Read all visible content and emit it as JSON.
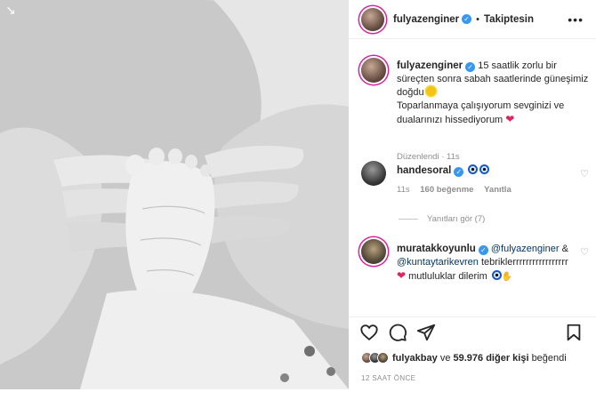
{
  "post": {
    "username": "fulyazenginer",
    "follow_status": "Takiptesin",
    "verified_badge": "✓"
  },
  "caption": {
    "username": "fulyazenginer",
    "line1": "15 saatlik zorlu bir süreçten sonra sabah saatlerinde güneşimiz doğdu",
    "line2": "Toparlanmaya çalışıyorum sevginizi ve dualarınızı hissediyorum",
    "edited": "Düzenlendi",
    "time": "11s"
  },
  "comments": [
    {
      "username": "handesoral",
      "time": "11s",
      "likes": "160 beğenme",
      "reply": "Yanıtla"
    },
    {
      "username": "muratakkoyunlu",
      "mention1": "@fulyazenginer",
      "amp": "&",
      "mention2": "@kuntaytarikevren",
      "text1": "tebriklerrrrrrrrrrrrrrrrr",
      "text2": "mutluluklar dilerim"
    }
  ],
  "replies_label": "Yanıtları gör (7)",
  "likes": {
    "first_liker": "fulyakbay",
    "connector": "ve",
    "others": "59.976 diğer kişi",
    "suffix": "beğendi"
  },
  "timestamp": "12 SAAT ÖNCE",
  "icons": {
    "like": "heart-icon",
    "comment": "comment-icon",
    "share": "send-icon",
    "save": "bookmark-icon",
    "more": "more-options-icon"
  },
  "colors": {
    "verified": "#3897f0",
    "heart": "#e0245e",
    "muted": "#8e8e8e",
    "mention": "#00376b"
  }
}
